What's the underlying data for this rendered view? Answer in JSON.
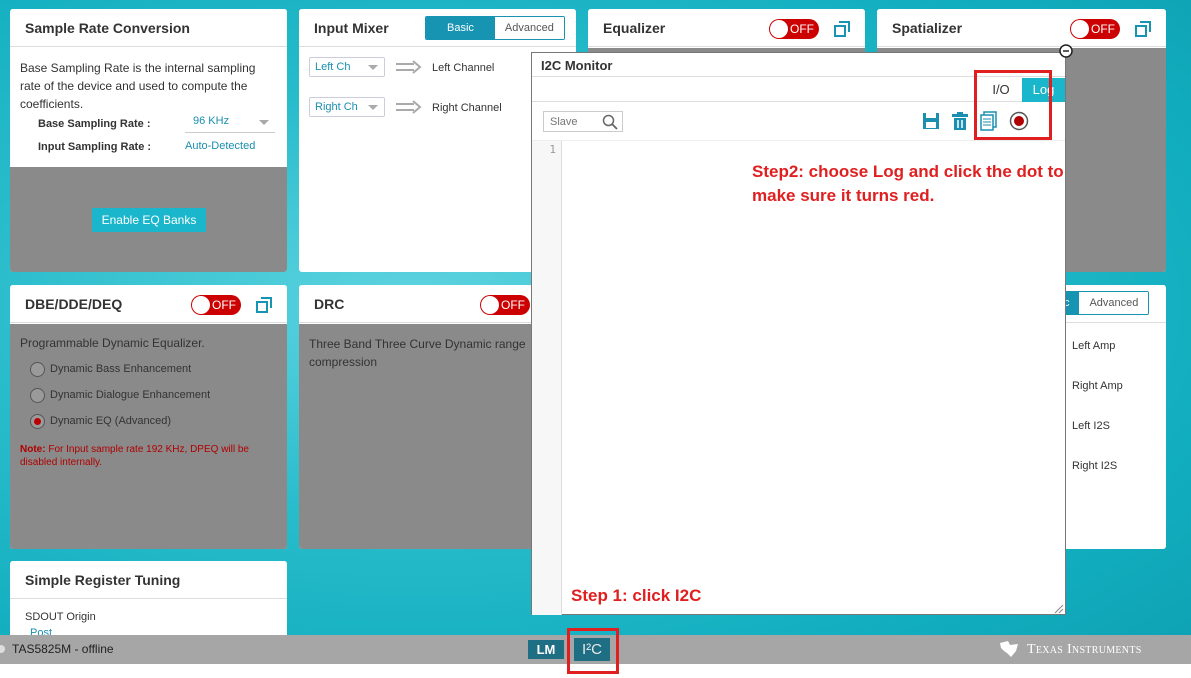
{
  "src": {
    "title": "Sample Rate Conversion",
    "description": "Base Sampling Rate is the internal sampling rate of the device and used to compute the coefficients.",
    "base_label": "Base Sampling Rate :",
    "base_value": "96 KHz",
    "input_label": "Input Sampling Rate :",
    "input_value": "Auto-Detected",
    "button": "Enable EQ Banks"
  },
  "mixer": {
    "title": "Input Mixer",
    "tab_basic": "Basic",
    "tab_advanced": "Advanced",
    "rows": [
      {
        "select": "Left Ch",
        "output": "Left Channel"
      },
      {
        "select": "Right Ch",
        "output": "Right Channel"
      }
    ]
  },
  "equalizer": {
    "title": "Equalizer",
    "toggle": "OFF"
  },
  "spatializer": {
    "title": "Spatializer",
    "toggle": "OFF"
  },
  "dbe": {
    "title": "DBE/DDE/DEQ",
    "toggle": "OFF",
    "description": "Programmable Dynamic Equalizer.",
    "options": [
      {
        "label": "Dynamic Bass Enhancement",
        "checked": false
      },
      {
        "label": "Dynamic Dialogue Enhancement",
        "checked": false
      },
      {
        "label": "Dynamic EQ (Advanced)",
        "checked": true
      }
    ],
    "note_label": "Note:",
    "note_text": "For Input sample rate 192 KHz, DPEQ will be disabled internally."
  },
  "drc": {
    "title": "DRC",
    "toggle": "OFF",
    "description": "Three Band Three Curve Dynamic range compression"
  },
  "output": {
    "tab_basic_partial": "sic",
    "tab_advanced": "Advanced",
    "items": [
      "Left Amp",
      "Right Amp",
      "Left I2S",
      "Right I2S"
    ]
  },
  "register": {
    "title": "Simple Register Tuning",
    "field_label": "SDOUT Origin",
    "field_value_partial": "Post"
  },
  "i2c_monitor": {
    "title": "I2C Monitor",
    "tab_io": "I/O",
    "tab_log": "Log",
    "slave_placeholder": "Slave",
    "line_number": "1"
  },
  "annotations": {
    "step1": "Step 1: click I2C",
    "step2": "Step2: choose Log and click the dot to make sure it turns red."
  },
  "status_bar": {
    "device": "TAS5825M - offline",
    "lm_button": "LM",
    "i2c_button": "I²C",
    "brand": "Texas Instruments"
  },
  "colors": {
    "accent": "#1694b1",
    "button_cyan": "#19b6cc",
    "off_toggle": "#cc0000",
    "annotation_red": "#e02020",
    "panel_grey": "#8a8a8a"
  }
}
